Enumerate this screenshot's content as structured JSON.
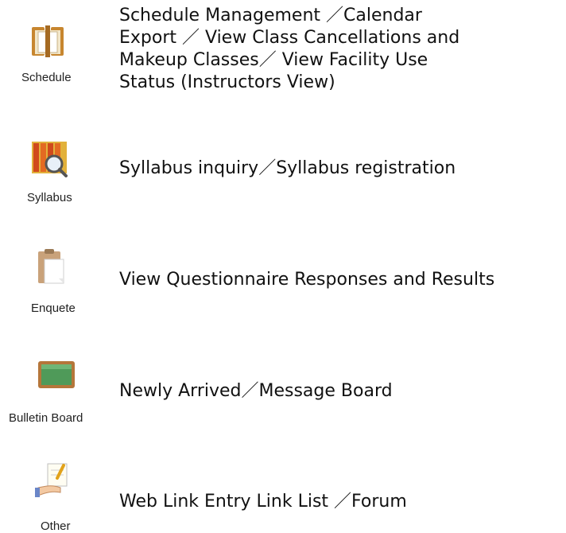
{
  "items": [
    {
      "icon": "schedule-folder-icon",
      "label": "Schedule",
      "description_lines": [
        "Schedule Management ／Calendar",
        "Export ／ View Class Cancellations and",
        "Makeup Classes／ View Facility Use",
        "Status (Instructors View)"
      ]
    },
    {
      "icon": "syllabus-books-magnifier-icon",
      "label": "Syllabus",
      "description": "Syllabus inquiry／Syllabus registration"
    },
    {
      "icon": "enquete-clipboard-icon",
      "label": "Enquete",
      "description": "View Questionnaire Responses and Results"
    },
    {
      "icon": "bulletin-board-chalkboard-icon",
      "label": "Bulletin Board",
      "description": "Newly Arrived／Message Board"
    },
    {
      "icon": "other-hand-note-icon",
      "label": "Other",
      "description": "Web Link Entry Link List ／Forum"
    }
  ]
}
